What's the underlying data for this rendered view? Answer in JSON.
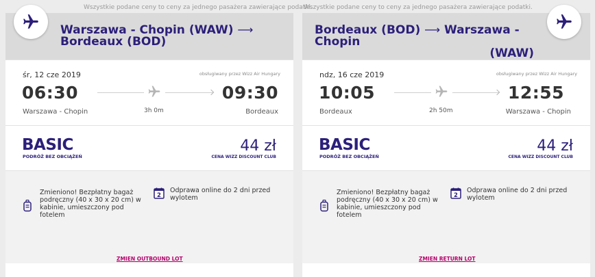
{
  "notice": "Wszystkie podane ceny to ceny za jednego pasażera zawierające podatki.",
  "flights": [
    {
      "route_line1": "Warszawa - Chopin (WAW) ",
      "route_arrow": "⟶",
      "route_line2": "Bordeaux (BOD)",
      "date": "śr, 12 cze 2019",
      "operator": "obsługiwany przez Wizz Air Hungary",
      "dep_time": "06:30",
      "arr_time": "09:30",
      "duration": "3h 0m",
      "dep_city": "Warszawa - Chopin",
      "arr_city": "Bordeaux",
      "fare_name": "BASIC",
      "fare_sub": "PODRÓŻ BEZ OBCIĄŻEŃ",
      "price": "44 zł",
      "price_sub": "CENA WIZZ DISCOUNT CLUB",
      "bag_text": "Zmieniono! Bezpłatny bagaż podręczny (40 x 30 x 20 cm) w kabinie, umieszczony pod fotelem",
      "checkin_text": "Odprawa online do 2 dni przed wylotem",
      "cal_num": "2",
      "change_label": "ZMIEN OUTBOUND LOT"
    },
    {
      "route_line1": "Bordeaux (BOD) ",
      "route_arrow": "⟶",
      "route_line1b": " Warszawa - Chopin",
      "route_line2": "(WAW)",
      "date": "ndz, 16 cze 2019",
      "operator": "obsługiwany przez Wizz Air Hungary",
      "dep_time": "10:05",
      "arr_time": "12:55",
      "duration": "2h 50m",
      "dep_city": "Bordeaux",
      "arr_city": "Warszawa - Chopin",
      "fare_name": "BASIC",
      "fare_sub": "PODRÓŻ BEZ OBCIĄŻEŃ",
      "price": "44 zł",
      "price_sub": "CENA WIZZ DISCOUNT CLUB",
      "bag_text": "Zmieniono! Bezpłatny bagaż podręczny (40 x 30 x 20 cm) w kabinie, umieszczony pod fotelem",
      "checkin_text": "Odprawa online do 2 dni przed wylotem",
      "cal_num": "2",
      "change_label": "ZMIEN RETURN LOT"
    }
  ],
  "colors": {
    "brand": "#2c1f7a",
    "link": "#b5006b"
  },
  "icons": [
    "airplane-icon",
    "cabin-bag-icon",
    "calendar-icon"
  ]
}
